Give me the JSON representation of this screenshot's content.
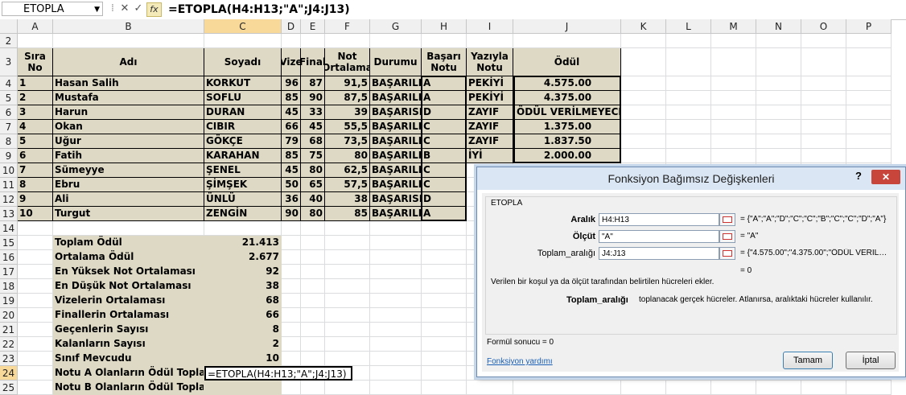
{
  "formula_bar": {
    "name_box": "ETOPLA",
    "formula": "=ETOPLA(H4:H13;\"A\";J4:J13)"
  },
  "columns": [
    "A",
    "B",
    "C",
    "D",
    "E",
    "F",
    "G",
    "H",
    "I",
    "J",
    "K",
    "L",
    "M",
    "N",
    "O",
    "P"
  ],
  "rows": [
    "2",
    "3",
    "4",
    "5",
    "6",
    "7",
    "8",
    "9",
    "10",
    "11",
    "12",
    "13",
    "14",
    "15",
    "16",
    "17",
    "18",
    "19",
    "20",
    "21",
    "22",
    "23",
    "24",
    "25"
  ],
  "table": {
    "headers": [
      "Sıra No",
      "Adı",
      "Soyadı",
      "Vize",
      "Final",
      "Not Ortalama",
      "Durumu",
      "Başarı Notu",
      "Yazıyla Notu",
      "Ödül"
    ],
    "rows": [
      [
        "1",
        "Hasan Salih",
        "KORKUT",
        "96",
        "87",
        "91,5",
        "BAŞARILI",
        "A",
        "PEKİYİ",
        "4.575.00"
      ],
      [
        "2",
        "Mustafa",
        "SOFLU",
        "85",
        "90",
        "87,5",
        "BAŞARILI",
        "A",
        "PEKİYİ",
        "4.375.00"
      ],
      [
        "3",
        "Harun",
        "DURAN",
        "45",
        "33",
        "39",
        "BAŞARISIZ",
        "D",
        "ZAYIF",
        "ÖDÜL VERİLMEYECEK"
      ],
      [
        "4",
        "Okan",
        "CIBIR",
        "66",
        "45",
        "55,5",
        "BAŞARILI",
        "C",
        "ZAYIF",
        "1.375.00"
      ],
      [
        "5",
        "Uğur",
        "GÖKÇE",
        "79",
        "68",
        "73,5",
        "BAŞARILI",
        "C",
        "ZAYIF",
        "1.837.50"
      ],
      [
        "6",
        "Fatih",
        "KARAHAN",
        "85",
        "75",
        "80",
        "BAŞARILI",
        "B",
        "İYİ",
        "2.000.00"
      ],
      [
        "7",
        "Sümeyye",
        "ŞENEL",
        "45",
        "80",
        "62,5",
        "BAŞARILI",
        "C",
        "",
        ""
      ],
      [
        "8",
        "Ebru",
        "ŞİMŞEK",
        "50",
        "65",
        "57,5",
        "BAŞARILI",
        "C",
        "",
        ""
      ],
      [
        "9",
        "Ali",
        "ÜNLÜ",
        "36",
        "40",
        "38",
        "BAŞARISIZ",
        "D",
        "",
        ""
      ],
      [
        "10",
        "Turgut",
        "ZENGİN",
        "90",
        "80",
        "85",
        "BAŞARILI",
        "A",
        "",
        ""
      ]
    ]
  },
  "summary": [
    {
      "label": "Toplam Ödül",
      "value": "21.413"
    },
    {
      "label": "Ortalama Ödül",
      "value": "2.677"
    },
    {
      "label": "En Yüksek Not Ortalaması",
      "value": "92"
    },
    {
      "label": "En Düşük Not Ortalaması",
      "value": "38"
    },
    {
      "label": "Vizelerin Ortalaması",
      "value": "68"
    },
    {
      "label": "Finallerin Ortalaması",
      "value": "66"
    },
    {
      "label": "Geçenlerin Sayısı",
      "value": "8"
    },
    {
      "label": "Kalanların Sayısı",
      "value": "2"
    },
    {
      "label": "Sınıf Mevcudu",
      "value": "10"
    },
    {
      "label": "Notu A Olanların Ödül Toplamı",
      "value": "=ETOPLA(H4:H13;\"A\";J4:J13)"
    },
    {
      "label": "Notu B Olanların Ödül Toplamı",
      "value": ""
    }
  ],
  "dialog": {
    "title": "Fonksiyon Bağımsız Değişkenleri",
    "help": "?",
    "close": "✕",
    "function_name": "ETOPLA",
    "args": [
      {
        "label": "Aralık",
        "value": "H4:H13",
        "result": "= {\"A\";\"A\";\"D\";\"C\";\"C\";\"B\";\"C\";\"C\";\"D\";\"A\"}",
        "bold": true
      },
      {
        "label": "Ölçüt",
        "value": "\"A\"",
        "result": "= \"A\"",
        "bold": true
      },
      {
        "label": "Toplam_aralığı",
        "value": "J4:J13",
        "result": "= {\"4.575.00\";\"4.375.00\";\"ÖDÜL VERİL…",
        "bold": false
      }
    ],
    "total": "= 0",
    "description": "Verilen bir koşul ya da ölçüt tarafından belirtilen hücreleri ekler.",
    "arg_help_name": "Toplam_aralığı",
    "arg_help_text": "toplanacak gerçek hücreler. Atlanırsa, aralıktaki hücreler kullanılır.",
    "formula_result": "Formül sonucu =   0",
    "help_link": "Fonksiyon yardımı",
    "ok": "Tamam",
    "cancel": "İptal"
  }
}
